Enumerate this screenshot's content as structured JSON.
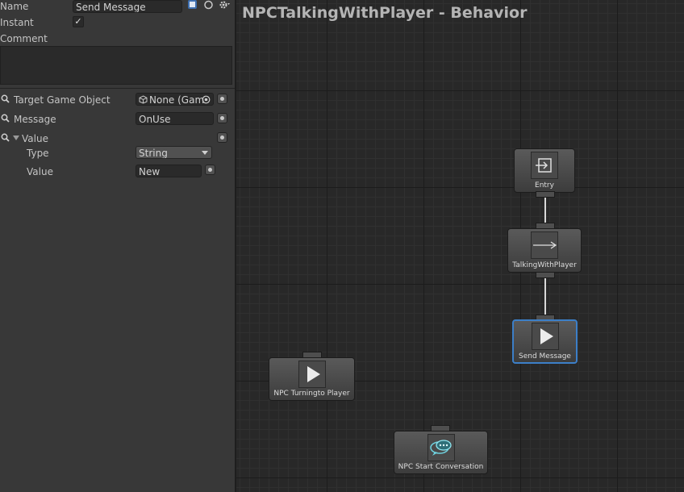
{
  "inspector": {
    "name_label": "Name",
    "name_value": "Send Message",
    "instant_label": "Instant",
    "instant_checked": true,
    "checkmark": "✓",
    "comment_label": "Comment",
    "comment_value": "",
    "target_label": "Target Game Object",
    "target_value": "None (Gam",
    "message_label": "Message",
    "message_value": "OnUse",
    "value_label": "Value",
    "type_label": "Type",
    "type_value": "String",
    "value_sub_label": "Value",
    "value_sub_value": "New",
    "toolbar_icons": [
      "help-icon",
      "preset-icon",
      "settings-gear-icon"
    ]
  },
  "graph": {
    "title": "NPCTalkingWithPlayer - Behavior",
    "nodes": [
      {
        "label": "Entry",
        "icon": "entry-icon"
      },
      {
        "label": "TalkingWithPlayer",
        "icon": "arrow-right-icon"
      },
      {
        "label": "Send Message",
        "icon": "play-icon",
        "selected": true
      },
      {
        "label": "NPC Turningto Player",
        "icon": "play-icon"
      },
      {
        "label": "NPC Start Conversation",
        "icon": "chat-bubbles-icon"
      }
    ]
  },
  "colors": {
    "panel_bg": "#383838",
    "graph_bg": "#282828",
    "selection": "#3c7fc8",
    "chat_icon": "#6fd3e0"
  }
}
